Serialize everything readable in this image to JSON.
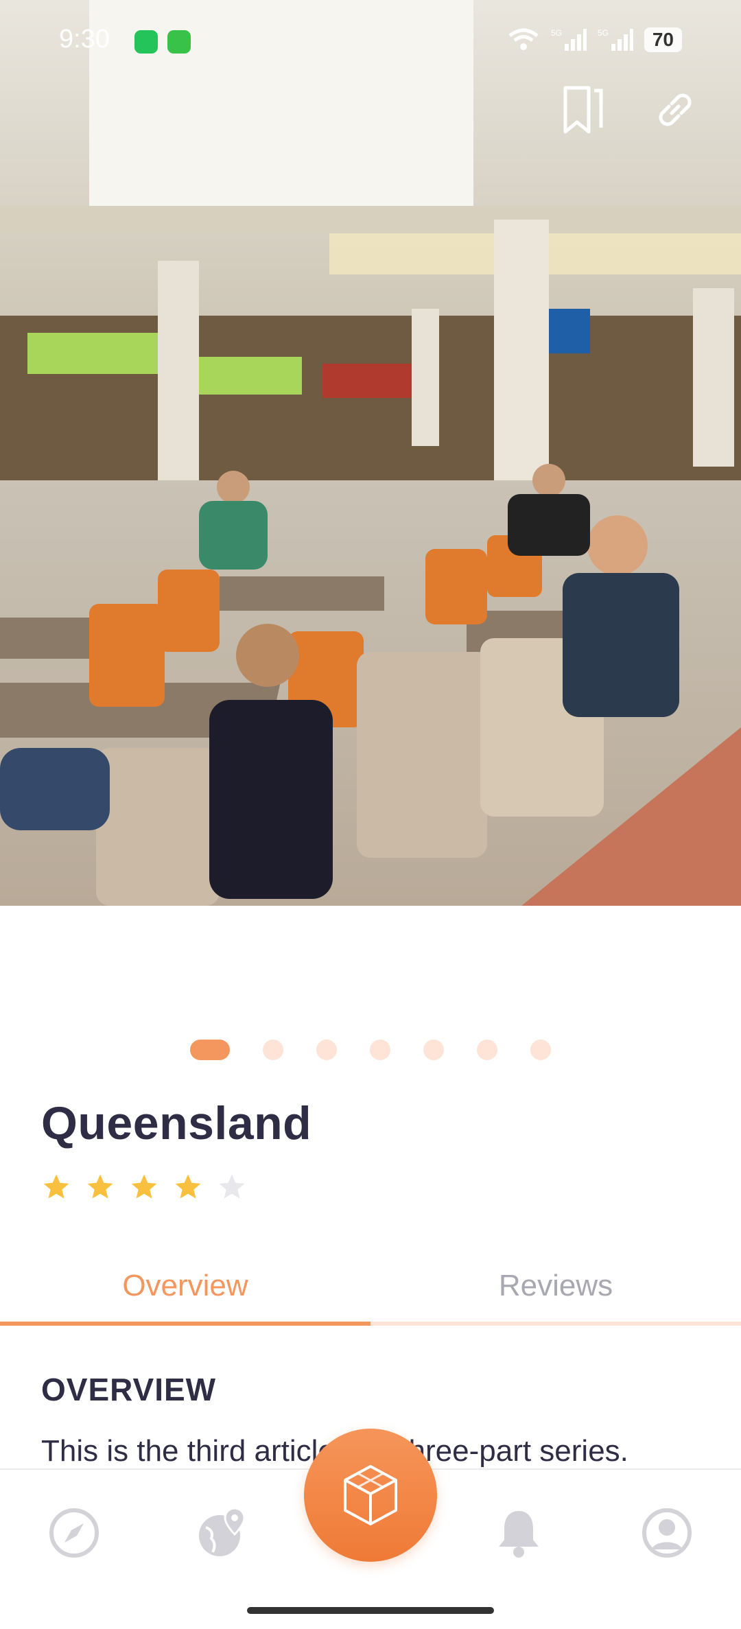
{
  "status_bar": {
    "time": "9:30",
    "battery": "70",
    "network_1": "5G",
    "network_2": "5G"
  },
  "hero": {
    "icons": [
      "bookmark-icon",
      "link-icon"
    ]
  },
  "carousel": {
    "total": 7,
    "active_index": 0
  },
  "place": {
    "title": "Queensland",
    "rating": 4,
    "rating_max": 5
  },
  "tabs": [
    {
      "label": "Overview",
      "active": true
    },
    {
      "label": "Reviews",
      "active": false
    }
  ],
  "overview": {
    "heading": "OVERVIEW",
    "text": "This is the third article in a three-part series."
  },
  "bottom_nav": {
    "items": [
      "compass-icon",
      "globe-pin-icon",
      "cube-icon",
      "bell-icon",
      "profile-icon"
    ]
  },
  "colors": {
    "accent": "#f4975e",
    "accent_light": "#fde4d6",
    "title": "#2f2d45",
    "star": "#f8c03e",
    "star_empty": "#e8e8ec",
    "nav_icon": "#d2d2d8"
  }
}
